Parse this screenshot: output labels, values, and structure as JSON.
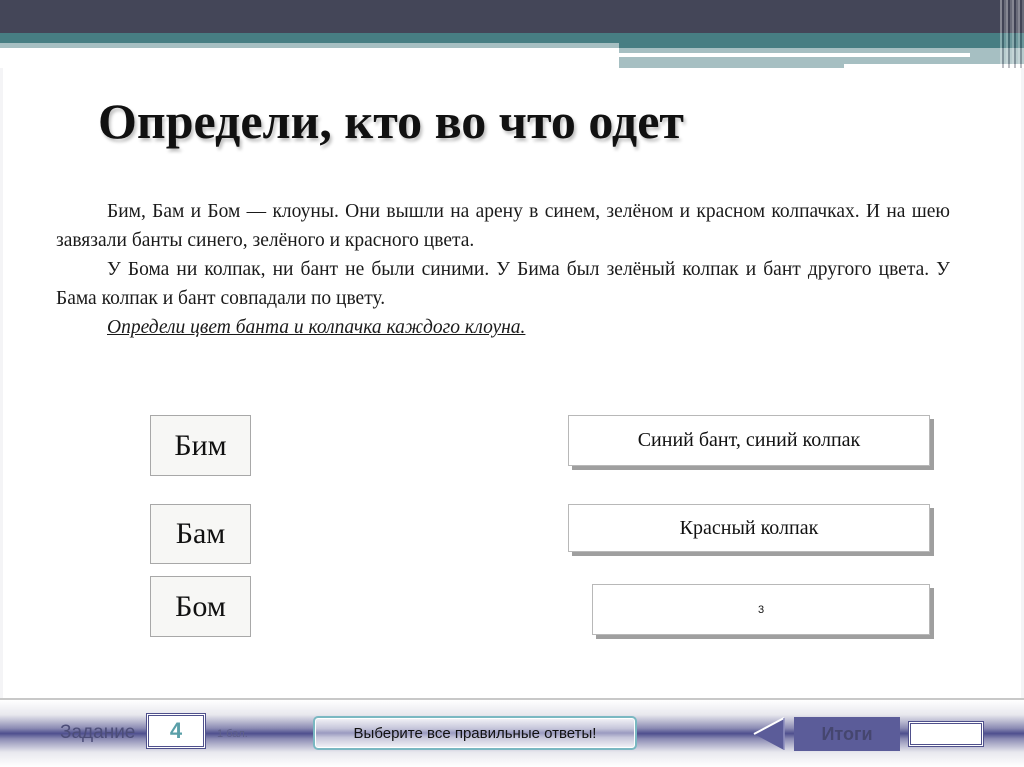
{
  "slide": {
    "title": "Определи, кто во что одет",
    "task": {
      "paragraphs": [
        "Бим, Бам и Бом — клоуны. Они вышли на арену в синем, зелёном и красном колпачках. И на шею завязали банты синего, зелёного и красного цвета.",
        "У Бома ни колпак, ни бант не были синими. У Бима был зелёный колпак и бант другого цвета. У Бама колпак и бант совпадали по цвету."
      ],
      "instruction": "Определи цвет банта и колпачка каждого клоуна."
    },
    "names": [
      {
        "label": "Бим"
      },
      {
        "label": "Бам"
      },
      {
        "label": "Бом"
      }
    ],
    "answers": [
      {
        "label": "Синий бант, синий колпак"
      },
      {
        "label": "Красный колпак"
      },
      {
        "label": "3"
      }
    ]
  },
  "footer": {
    "task_label": "Задание",
    "task_number": "4",
    "points": "1 бал.",
    "hint": "Выберите все правильные ответы!",
    "back_icon": "triangle-left-icon",
    "results_label": "Итоги",
    "answer_value": ""
  },
  "colors": {
    "header_dark": "#444658",
    "header_teal": "#477e83",
    "header_light": "#a6bfc2",
    "footer_accent": "#4e4f8e",
    "task_number": "#5a9fa8"
  }
}
